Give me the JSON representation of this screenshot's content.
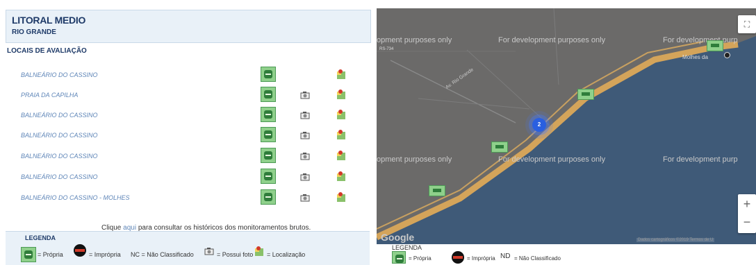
{
  "header": {
    "region": "LITORAL MEDIO",
    "city": "RIO GRANDE"
  },
  "section_title": "LOCAIS DE AVALIAÇÃO",
  "locations": [
    {
      "name": "BALNEÁRIO DO CASSINO",
      "has_photo": false
    },
    {
      "name": "PRAIA DA CAPILHA",
      "has_photo": true
    },
    {
      "name": "BALNEÁRIO DO CASSINO",
      "has_photo": true
    },
    {
      "name": "BALNEÁRIO DO CASSINO",
      "has_photo": true
    },
    {
      "name": "BALNEÁRIO DO CASSINO",
      "has_photo": true
    },
    {
      "name": "BALNEÁRIO DO CASSINO",
      "has_photo": true
    },
    {
      "name": "BALNEÁRIO DO CASSINO - MOLHES",
      "has_photo": true
    }
  ],
  "history_note": {
    "before": "Clique ",
    "link": "aqui",
    "after": " para consultar os históricos dos monitoramentos brutos."
  },
  "legend": {
    "title": "LEGENDA",
    "propria": "= Própria",
    "impropria": "= Imprópria",
    "nc": "NC = Não Classificado",
    "foto": "= Possui foto",
    "localizacao": "= Localização"
  },
  "map": {
    "watermark": "For development purposes only",
    "watermark_cut_left": "opment purposes only",
    "watermark_cut_right": "For development purp",
    "place_label": "Molhes da",
    "cluster_count": "2",
    "road_labels": [
      "RS-734",
      "Av. Rio Grande"
    ],
    "logo": "Google",
    "attribution": "Dados cartográficos ©2019  Termos de U",
    "zoom_in": "+",
    "zoom_out": "−",
    "fullscreen_icon": "fullscreen-icon",
    "legend": {
      "title": "LEGENDA",
      "propria": "= Própria",
      "impropria": "= Imprópria",
      "nd": "ND",
      "nc": "= Não Classificado"
    }
  },
  "colors": {
    "accent": "#1e3a68",
    "link": "#5f86b8",
    "ocean": "#3f5a78",
    "land": "#6b6a69",
    "shore": "#d4a45a"
  }
}
